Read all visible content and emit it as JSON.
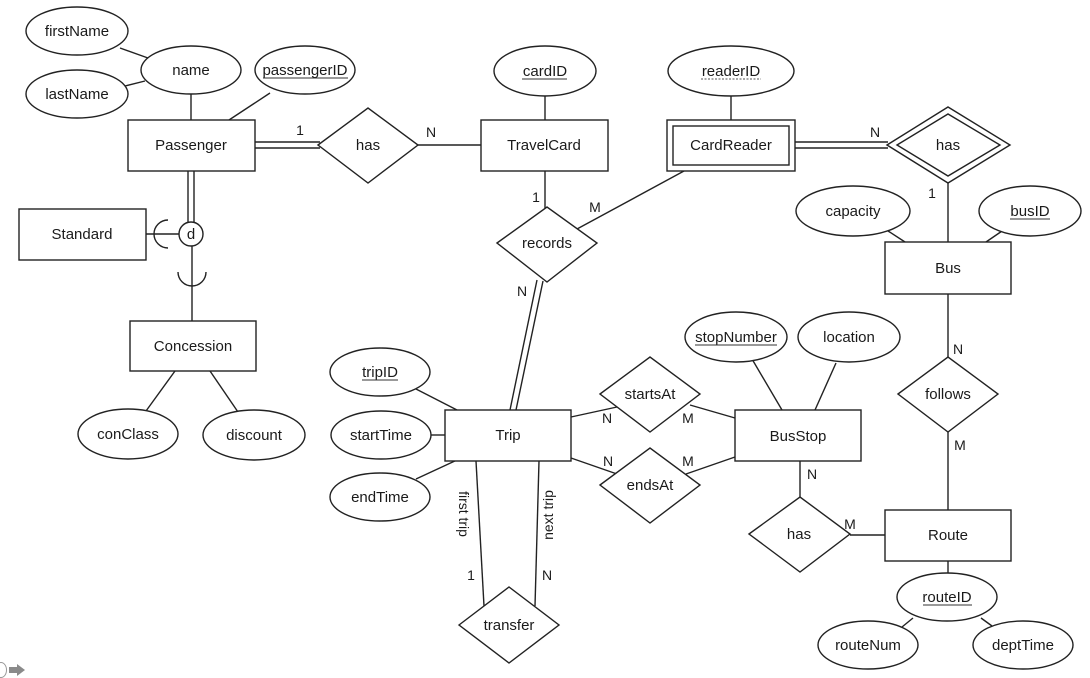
{
  "diagram": {
    "type": "ER diagram",
    "entities": {
      "passenger": "Passenger",
      "travelcard": "TravelCard",
      "cardreader": "CardReader",
      "standard": "Standard",
      "concession": "Concession",
      "bus": "Bus",
      "trip": "Trip",
      "busstop": "BusStop",
      "route": "Route"
    },
    "relationships": {
      "passenger_has": "has",
      "records": "records",
      "bus_has": "has",
      "startsat": "startsAt",
      "endsat": "endsAt",
      "follows": "follows",
      "stop_has": "has",
      "transfer": "transfer"
    },
    "attributes": {
      "firstname": "firstName",
      "lastname": "lastName",
      "name": "name",
      "passengerid": "passengerID",
      "cardid": "cardID",
      "readerid": "readerID",
      "capacity": "capacity",
      "busid": "busID",
      "conclass": "conClass",
      "discount": "discount",
      "tripid": "tripID",
      "starttime": "startTime",
      "endtime": "endTime",
      "stopnumber": "stopNumber",
      "location": "location",
      "routeid": "routeID",
      "routenum": "routeNum",
      "depttime": "deptTime"
    },
    "specialization": {
      "symbol": "d"
    },
    "cardinalities": {
      "passenger_has_1": "1",
      "passenger_has_n": "N",
      "cardreader_has_n": "N",
      "bus_has_1": "1",
      "travelcard_records_1": "1",
      "cardreader_records_m": "M",
      "trip_records_n": "N",
      "trip_startsat_n": "N",
      "busstop_startsat_m": "M",
      "trip_endsat_n": "N",
      "busstop_endsat_m": "M",
      "bus_follows_n": "N",
      "route_follows_m": "M",
      "busstop_has_n": "N",
      "route_has_m": "M",
      "transfer_first_1": "1",
      "transfer_next_n": "N"
    },
    "role_labels": {
      "first_trip": "first trip",
      "next_trip": "next trip"
    }
  }
}
